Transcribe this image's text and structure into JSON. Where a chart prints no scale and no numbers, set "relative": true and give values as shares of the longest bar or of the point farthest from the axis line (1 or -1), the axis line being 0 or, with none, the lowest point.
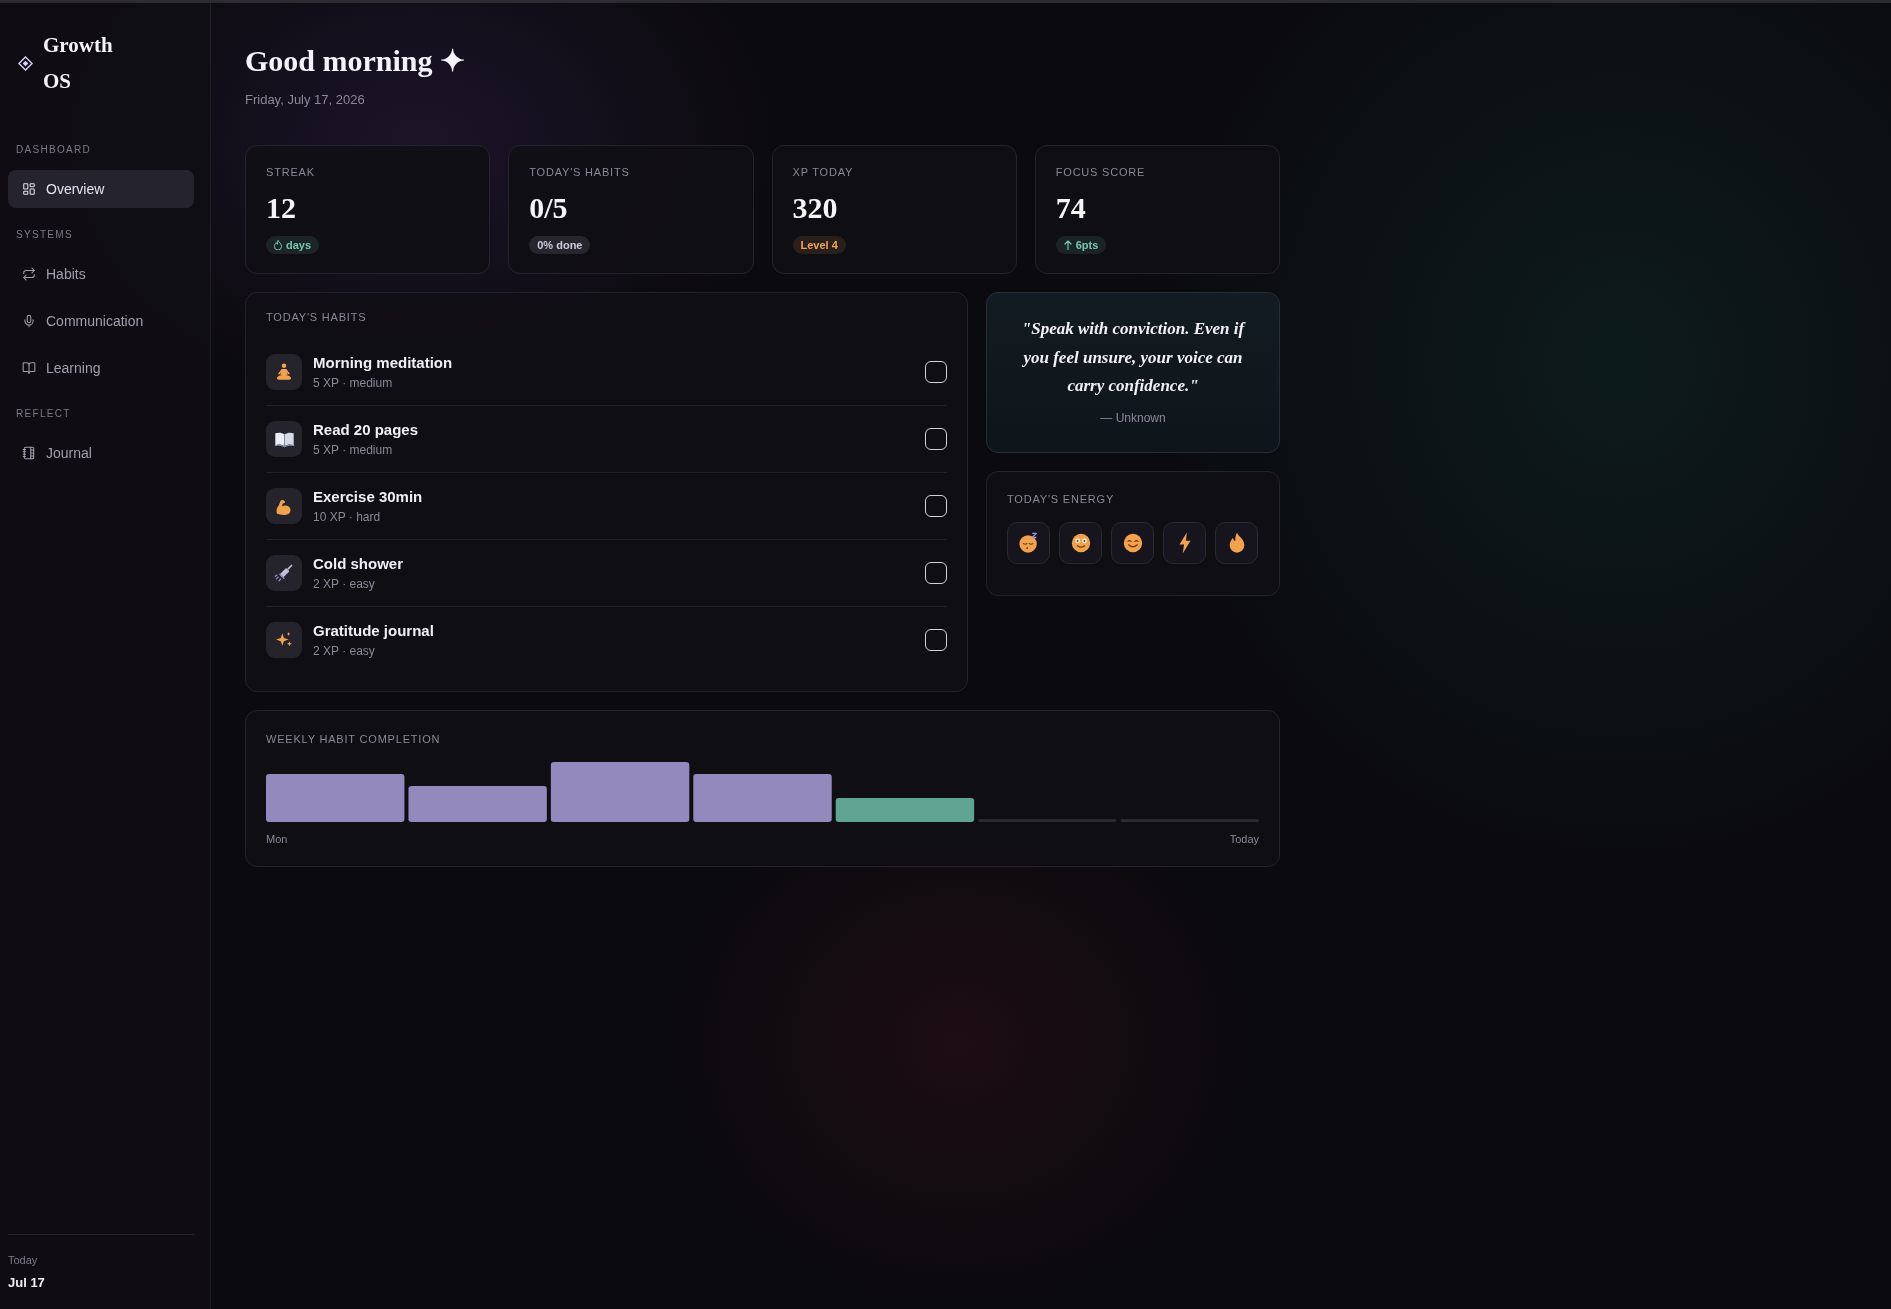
{
  "sidebar": {
    "logo": "Growth OS",
    "sections": [
      {
        "label": "DASHBOARD",
        "items": [
          {
            "label": "Overview",
            "selected": true
          }
        ]
      },
      {
        "label": "SYSTEMS",
        "items": [
          {
            "label": "Habits",
            "selected": false
          },
          {
            "label": "Communication",
            "selected": false
          },
          {
            "label": "Learning",
            "selected": false
          }
        ]
      },
      {
        "label": "REFLECT",
        "items": [
          {
            "label": "Journal",
            "selected": false
          }
        ]
      }
    ],
    "footer": {
      "label": "Today",
      "date": "Jul 17"
    }
  },
  "header": {
    "greeting": "Good morning ✦",
    "date": "Friday, July 17, 2026"
  },
  "stats": [
    {
      "label": "STREAK",
      "value": "12",
      "badge": {
        "text": "days",
        "color": "#74c9a9"
      }
    },
    {
      "label": "TODAY'S HABITS",
      "value": "0/5",
      "badge": {
        "text": "0% done",
        "color": "#d0ccdf"
      }
    },
    {
      "label": "XP TODAY",
      "value": "320",
      "badge": {
        "text": "Level 4",
        "color": "#f0a65c"
      }
    },
    {
      "label": "FOCUS SCORE",
      "value": "74",
      "badge": {
        "text": "6pts",
        "color": "#74c9a9"
      }
    }
  ],
  "habits": {
    "title": "TODAY'S HABITS",
    "items": [
      {
        "name": "Morning meditation",
        "meta": "5 XP · medium",
        "checked": false
      },
      {
        "name": "Read 20 pages",
        "meta": "5 XP · medium",
        "checked": false
      },
      {
        "name": "Exercise 30min",
        "meta": "10 XP · hard",
        "checked": false
      },
      {
        "name": "Cold shower",
        "meta": "2 XP · easy",
        "checked": false
      },
      {
        "name": "Gratitude journal",
        "meta": "2 XP · easy",
        "checked": false
      }
    ]
  },
  "quote": {
    "text": "\"Speak with conviction. Even if you feel unsure, your voice can carry confidence.\"",
    "author": "— Unknown"
  },
  "energy": {
    "title": "TODAY'S ENERGY",
    "options": [
      {
        "selected": false
      },
      {
        "selected": false
      },
      {
        "selected": false
      },
      {
        "selected": false
      },
      {
        "selected": false
      }
    ]
  },
  "weekly": {
    "chart_data": {
      "type": "bar",
      "title": "WEEKLY HABIT COMPLETION",
      "stacked": true,
      "relative": true,
      "categories": [
        "Mon",
        null,
        null,
        null,
        null,
        null,
        "Today"
      ],
      "series": [
        {
          "color": "#9489bd",
          "values": [
            0.8,
            0.6,
            1.0,
            0.8,
            null,
            null,
            null
          ]
        },
        {
          "color": "#5fa592",
          "values": [
            null,
            null,
            null,
            null,
            0.4,
            null,
            null
          ]
        },
        {
          "color": "#2a2831",
          "values": [
            null,
            null,
            null,
            null,
            null,
            0,
            0
          ]
        }
      ]
    }
  }
}
